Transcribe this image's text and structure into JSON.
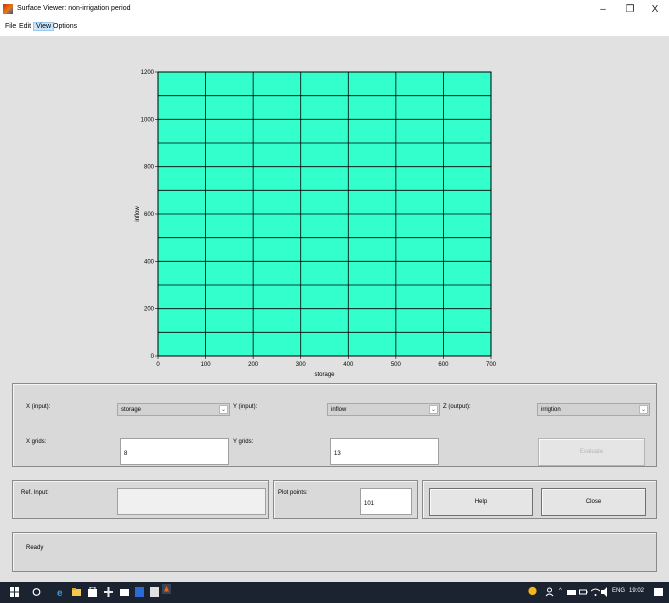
{
  "window": {
    "title": "Surface Viewer: non-irrigation period",
    "minimize_glyph": "–",
    "maximize_glyph": "❐",
    "close_glyph": "X"
  },
  "menu": [
    "File",
    "Edit",
    "View",
    "Options"
  ],
  "menu_active": "View",
  "chart_data": {
    "type": "heatmap",
    "xlabel": "storage",
    "ylabel": "inflow",
    "xlim": [
      0,
      700
    ],
    "ylim": [
      0,
      1200
    ],
    "x_ticks": [
      0,
      100,
      200,
      300,
      400,
      500,
      600,
      700
    ],
    "y_ticks": [
      0,
      200,
      400,
      600,
      800,
      1000,
      1200
    ],
    "x_grid_count": 8,
    "y_grid_count": 13,
    "grid": true,
    "fill_color": "#33ffcc",
    "line_color": "#000000"
  },
  "controls": {
    "x_input_label": "X (input):",
    "x_input_value": "storage",
    "y_input_label": "Y (input):",
    "y_input_value": "inflow",
    "z_output_label": "Z (output):",
    "z_output_value": "irrigtion",
    "x_grids_label": "X grids:",
    "x_grids_value": "8",
    "y_grids_label": "Y grids:",
    "y_grids_value": "13",
    "evaluate_label": "Evaluate",
    "ref_input_label": "Ref. Input:",
    "ref_input_value": "",
    "plot_points_label": "Plot points:",
    "plot_points_value": "101",
    "help_label": "Help",
    "close_label": "Close",
    "status_text": "Ready"
  },
  "taskbar": {
    "tray_lang": "ENG",
    "tray_time": "19:02"
  }
}
